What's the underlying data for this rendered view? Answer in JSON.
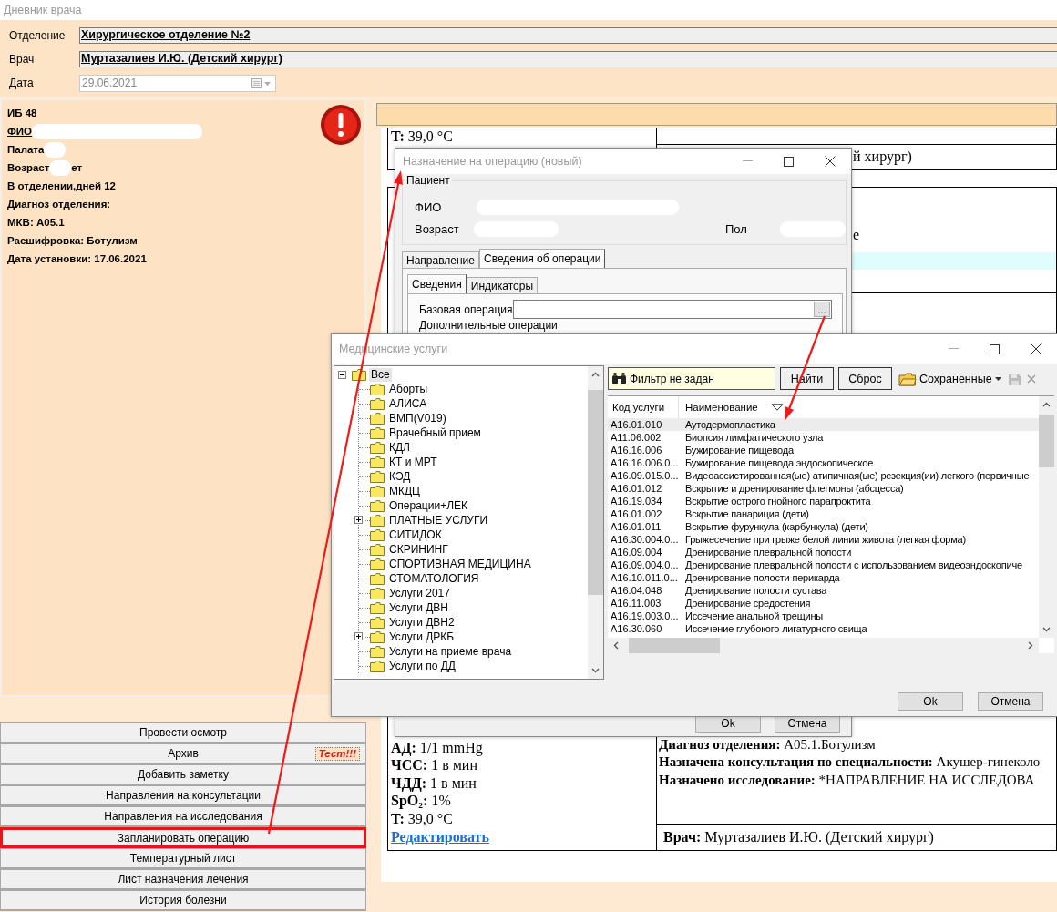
{
  "window": {
    "title": "Дневник врача"
  },
  "header": {
    "fields": [
      {
        "label": "Отделение",
        "value": "Хирургическое отделение №2",
        "kind": "readonly"
      },
      {
        "label": "Врач",
        "value": "Муртазалиев И.Ю. (Детский хирург)",
        "kind": "readonly"
      },
      {
        "label": "Дата",
        "value": "29.06.2021",
        "kind": "date",
        "disabled": true
      }
    ]
  },
  "patient": {
    "alert": true,
    "lines": [
      {
        "text": "ИБ 48",
        "kind": "plain",
        "redacted": false
      },
      {
        "text": "ФИО",
        "kind": "link",
        "redacted": true
      },
      {
        "text": "Палата",
        "kind": "plain",
        "redacted": true
      },
      {
        "text": "Возраст",
        "kind": "plain",
        "redacted": true,
        "suffix": "ет"
      },
      {
        "text": "В отделении,дней 12",
        "kind": "plain",
        "redacted": false
      },
      {
        "text": "Диагноз отделения:",
        "kind": "plain",
        "redacted": false
      },
      {
        "text": "МКВ: A05.1",
        "kind": "plain",
        "redacted": false
      },
      {
        "text": "Расшифровка: Ботулизм",
        "kind": "plain",
        "redacted": false
      },
      {
        "text": "Дата установки: 17.06.2021",
        "kind": "plain",
        "redacted": false
      }
    ]
  },
  "actions": [
    {
      "label": "Провести осмотр",
      "highlighted": false
    },
    {
      "label": "Архив",
      "highlighted": false,
      "badge": "Тест!!!"
    },
    {
      "label": "Добавить заметку",
      "highlighted": false
    },
    {
      "label": "Направления на консультации",
      "highlighted": false
    },
    {
      "label": "Направления на исследования",
      "highlighted": false
    },
    {
      "label": "Запланировать операцию",
      "highlighted": true
    },
    {
      "label": "Температурный лист",
      "highlighted": false
    },
    {
      "label": "Лист назначения лечения",
      "highlighted": false
    },
    {
      "label": "История болезни",
      "highlighted": false
    }
  ],
  "document": {
    "top_note": {
      "label": "T:",
      "value": "39,0 °C"
    },
    "fragments": [
      "й хирург)",
      "е"
    ],
    "vitals": [
      {
        "label": "АД:",
        "value": "1/1 mmHg"
      },
      {
        "label": "ЧСС:",
        "value": "1 в мин"
      },
      {
        "label": "ЧДД:",
        "value": "1 в мин"
      },
      {
        "label": "SpO₂:",
        "value": "1%"
      },
      {
        "label": "T:",
        "value": "39,0 °C"
      }
    ],
    "edit_link": "Редактировать",
    "summary": [
      {
        "label": "Диагноз отделения:",
        "value": "A05.1.Ботулизм"
      },
      {
        "label": "Назначена консультация по специальности:",
        "value": "Акушер-гинеколо"
      },
      {
        "label": "Назначено исследование:",
        "value": "*НАПРАВЛЕНИЕ НА ИССЛЕДОВА"
      }
    ],
    "doctor": {
      "label": "Врач:",
      "value": "Муртазалиев И.Ю. (Детский хирург)"
    }
  },
  "operation_dialog": {
    "title": "Назначение на операцию (новый)",
    "patient_group": {
      "title": "Пациент",
      "fields": [
        {
          "label": "ФИО"
        },
        {
          "label": "Возраст"
        },
        {
          "label": "Пол"
        }
      ]
    },
    "tabs": [
      {
        "label": "Направление",
        "selected": false
      },
      {
        "label": "Сведения об операции",
        "selected": true
      }
    ],
    "subtabs": [
      {
        "label": "Сведения",
        "selected": true
      },
      {
        "label": "Индикаторы",
        "selected": false
      }
    ],
    "base_operation": {
      "label": "Базовая операция",
      "button": "..."
    },
    "extra_label": "Дополнительные операции",
    "buttons": [
      "Ok",
      "Отмена"
    ]
  },
  "services_dialog": {
    "title": "Медицинские услуги",
    "tree": {
      "label": "Все",
      "expanded": true,
      "selected": true,
      "children": [
        {
          "label": "Аборты",
          "collapsed": false,
          "selected": false
        },
        {
          "label": "АЛИСА",
          "collapsed": false,
          "selected": false
        },
        {
          "label": "ВМП(V019)",
          "collapsed": false,
          "selected": false
        },
        {
          "label": "Врачебный прием",
          "collapsed": false,
          "selected": false
        },
        {
          "label": "КДЛ",
          "collapsed": false,
          "selected": false
        },
        {
          "label": "КТ и МРТ",
          "collapsed": false,
          "selected": false
        },
        {
          "label": "КЭД",
          "collapsed": false,
          "selected": false
        },
        {
          "label": "МКДЦ",
          "collapsed": false,
          "selected": false
        },
        {
          "label": "Операции+ЛЕК",
          "collapsed": false,
          "selected": false
        },
        {
          "label": "ПЛАТНЫЕ УСЛУГИ",
          "collapsed": true,
          "selected": false
        },
        {
          "label": "СИТИДОК",
          "collapsed": false,
          "selected": false
        },
        {
          "label": "СКРИНИНГ",
          "collapsed": false,
          "selected": false
        },
        {
          "label": "СПОРТИВНАЯ МЕДИЦИНА",
          "collapsed": false,
          "selected": false
        },
        {
          "label": "СТОМАТОЛОГИЯ",
          "collapsed": false,
          "selected": false
        },
        {
          "label": "Услуги 2017",
          "collapsed": false,
          "selected": false
        },
        {
          "label": "Услуги ДВН",
          "collapsed": false,
          "selected": false
        },
        {
          "label": "Услуги ДВН2",
          "collapsed": false,
          "selected": false
        },
        {
          "label": "Услуги ДРКБ",
          "collapsed": true,
          "selected": false
        },
        {
          "label": "Услуги на приеме врача",
          "collapsed": false,
          "selected": false
        },
        {
          "label": "Услуги по ДД",
          "collapsed": false,
          "selected": false
        }
      ]
    },
    "filter": {
      "link": "Фильтр не задан"
    },
    "toolbar_buttons": [
      "Найти",
      "Сброс"
    ],
    "saved": "Сохраненные",
    "columns": [
      "Код услуги",
      "Наименование"
    ],
    "rows": [
      {
        "code": "A16.01.010",
        "name": "Аутодермопластика",
        "selected": true
      },
      {
        "code": "A11.06.002",
        "name": "Биопсия лимфатического узла",
        "selected": false
      },
      {
        "code": "A16.16.006",
        "name": "Бужирование пищевода",
        "selected": false
      },
      {
        "code": "A16.16.006.0...",
        "name": "Бужирование пищевода эндоскопическое",
        "selected": false
      },
      {
        "code": "A16.09.015.0...",
        "name": "Видеоассистированная(ые) атипичная(ые) резекция(ии) легкого (первичные",
        "selected": false
      },
      {
        "code": "A16.01.012",
        "name": "Вскрытие и дренирование флегмоны (абсцесса)",
        "selected": false
      },
      {
        "code": "A16.19.034",
        "name": "Вскрытие острого гнойного парапроктита",
        "selected": false
      },
      {
        "code": "A16.01.002",
        "name": "Вскрытие панариция (дети)",
        "selected": false
      },
      {
        "code": "A16.01.011",
        "name": "Вскрытие фурункула (карбункула) (дети)",
        "selected": false
      },
      {
        "code": "A16.30.004.0...",
        "name": "Грыжесечение при грыже белой линии живота (легкая форма)",
        "selected": false
      },
      {
        "code": "A16.09.004",
        "name": "Дренирование плевральной полости",
        "selected": false
      },
      {
        "code": "A16.09.004.0...",
        "name": "Дренирование плевральной полости с использованием видеоэндоскопиче",
        "selected": false
      },
      {
        "code": "A16.10.011.0...",
        "name": "Дренирование полости перикарда",
        "selected": false
      },
      {
        "code": "A16.04.048",
        "name": "Дренирование полости сустава",
        "selected": false
      },
      {
        "code": "A16.11.003",
        "name": "Дренирование средостения",
        "selected": false
      },
      {
        "code": "A16.19.003.0...",
        "name": "Иссечение анальной трещины",
        "selected": false
      },
      {
        "code": "A16.30.060",
        "name": "Иссечение глубокого лигатурного свища",
        "selected": false
      }
    ],
    "buttons": [
      "Ok",
      "Отмена"
    ]
  },
  "annotations": [
    {
      "kind": "arrow"
    },
    {
      "kind": "arrow"
    }
  ]
}
